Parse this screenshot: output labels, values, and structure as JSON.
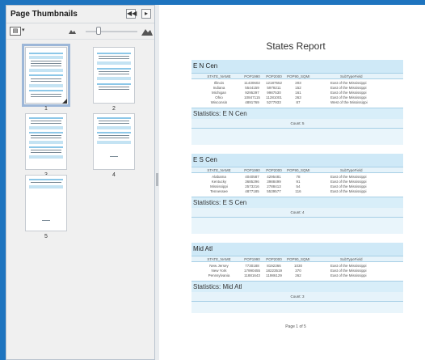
{
  "panel": {
    "title": "Page Thumbnails",
    "collapse_glyph": "◀◀",
    "close_glyph": "▸",
    "options_icon": "thumbnail-options-icon",
    "zoom_out_icon": "small-mountain-icon",
    "zoom_in_icon": "large-mountain-icon",
    "thumbnails": [
      {
        "label": "1",
        "selected": true
      },
      {
        "label": "2",
        "selected": false
      },
      {
        "label": "3",
        "selected": false
      },
      {
        "label": "4",
        "selected": false
      },
      {
        "label": "5",
        "selected": false
      }
    ]
  },
  "report": {
    "title": "States Report",
    "columns": [
      "STATE_NAME",
      "POP1990",
      "POP2000",
      "POP90_SQMI",
      "SubTypeField"
    ],
    "groups": [
      {
        "name": "E N Cen",
        "rows": [
          [
            "Illinois",
            "11430602",
            "12187552",
            "203",
            "East of the Mississippi"
          ],
          [
            "Indiana",
            "5544159",
            "5979211",
            "152",
            "East of the Mississippi"
          ],
          [
            "Michigan",
            "9295297",
            "9987530",
            "161",
            "East of the Mississippi"
          ],
          [
            "Ohio",
            "10847115",
            "11281001",
            "263",
            "East of the Mississippi"
          ],
          [
            "Wisconsin",
            "4891769",
            "5277933",
            "87",
            "West of the Mississippi"
          ]
        ],
        "stats_label": "Statistics: E N Cen",
        "count": "Count: 5"
      },
      {
        "name": "E S Cen",
        "rows": [
          [
            "Alabama",
            "4040587",
            "4295481",
            "78",
            "East of the Mississippi"
          ],
          [
            "Kentucky",
            "3685296",
            "3988499",
            "91",
            "East of the Mississippi"
          ],
          [
            "Mississippi",
            "2573216",
            "2788413",
            "54",
            "East of the Mississippi"
          ],
          [
            "Tennessee",
            "4877185",
            "5539577",
            "116",
            "East of the Mississippi"
          ]
        ],
        "stats_label": "Statistics: E S Cen",
        "count": "Count: 4"
      },
      {
        "name": "Mid Atl",
        "rows": [
          [
            "New Jersey",
            "7730188",
            "8192366",
            "1030",
            "East of the Mississippi"
          ],
          [
            "New York",
            "17990455",
            "18223519",
            "370",
            "East of the Mississippi"
          ],
          [
            "Pennsylvania",
            "11881643",
            "11986129",
            "262",
            "East of the Mississippi"
          ]
        ],
        "stats_label": "Statistics: Mid Atl",
        "count": "Count: 3"
      }
    ],
    "footer": "Page 1 of 5"
  }
}
